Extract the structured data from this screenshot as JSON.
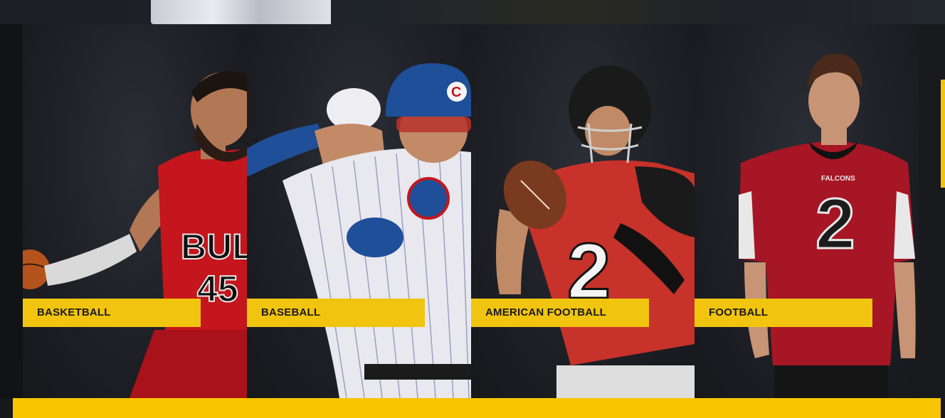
{
  "sports": [
    {
      "label": "BASKETBALL"
    },
    {
      "label": "BASEBALL"
    },
    {
      "label": "AMERICAN FOOTBALL"
    },
    {
      "label": "FOOTBALL"
    }
  ],
  "jerseys": {
    "basketball_text": "BULLS",
    "basketball_number": "45",
    "american_football_number": "2",
    "football_number": "2",
    "helmet_logo": "C",
    "team_patch": "FALCONS"
  },
  "colors": {
    "accent": "#f1c40f",
    "bottom_bar": "#f8c500",
    "background": "#17181c"
  }
}
